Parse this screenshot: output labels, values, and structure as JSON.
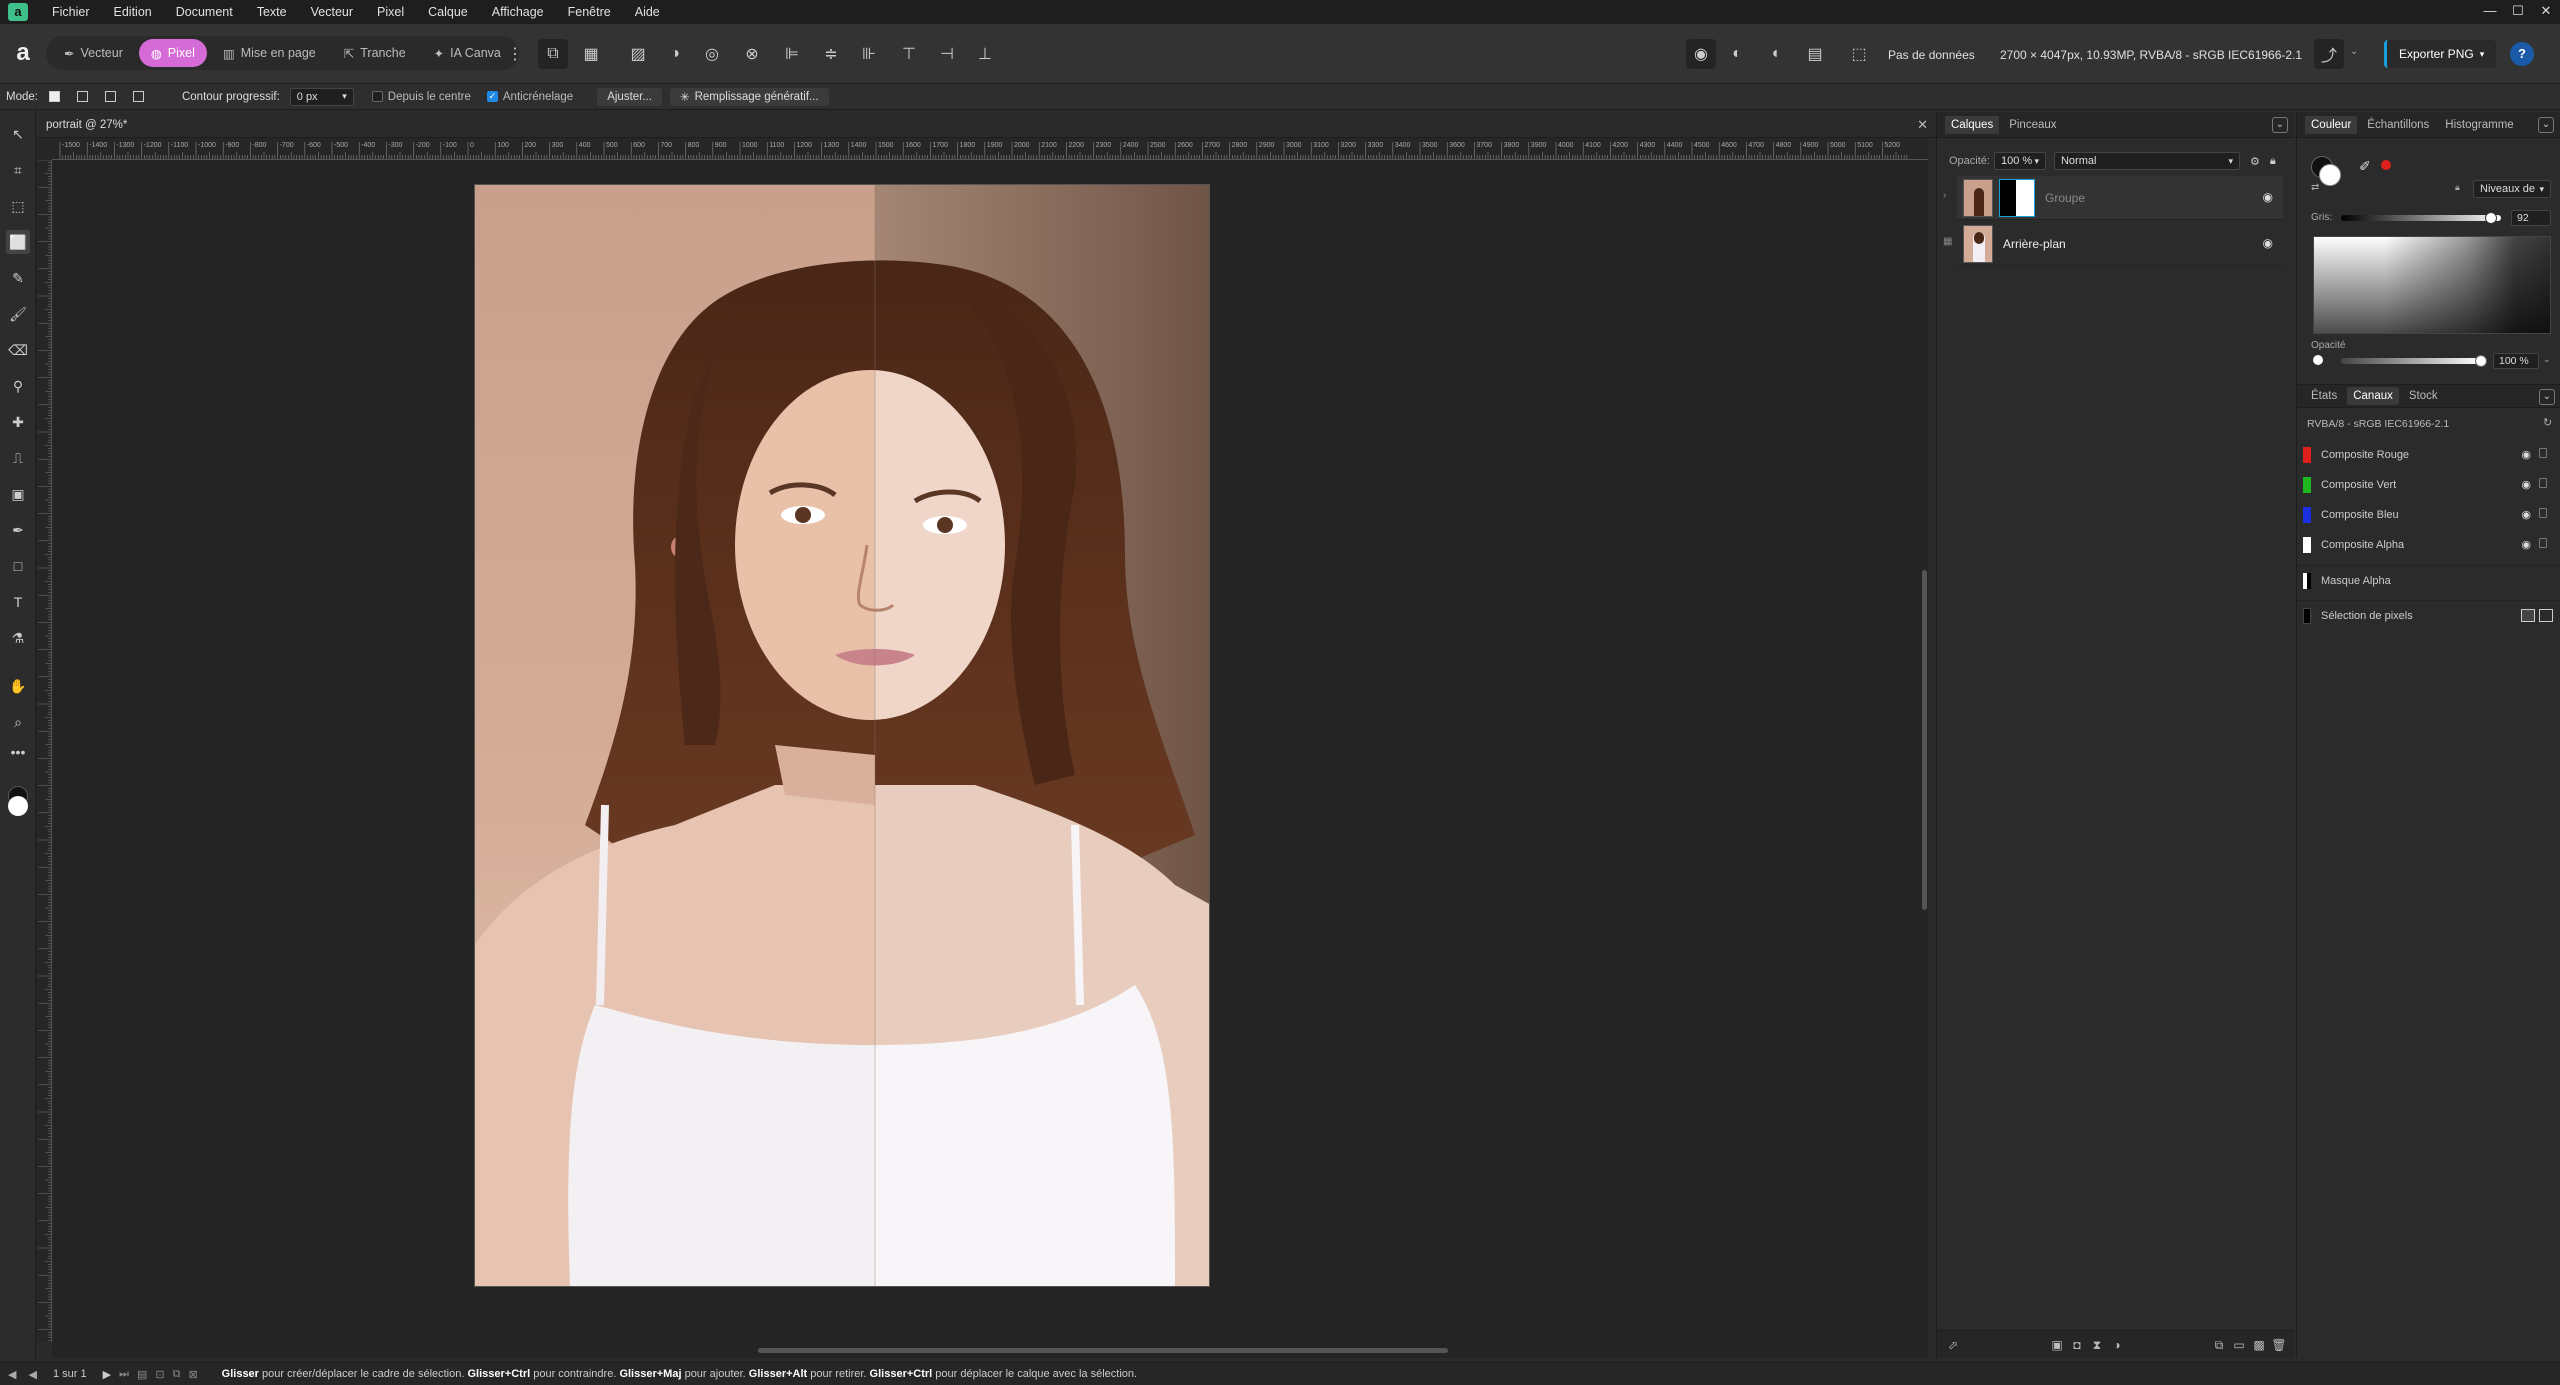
{
  "menu": {
    "items": [
      "Fichier",
      "Edition",
      "Document",
      "Texte",
      "Vecteur",
      "Pixel",
      "Calque",
      "Affichage",
      "Fenêtre",
      "Aide"
    ],
    "window_controls": [
      "—",
      "☐",
      "✕"
    ]
  },
  "toolbar": {
    "personas": [
      {
        "label": "Vecteur",
        "icon": "vector-pen-icon",
        "active": false
      },
      {
        "label": "Pixel",
        "icon": "pixel-icon",
        "active": true
      },
      {
        "label": "Mise en page",
        "icon": "layout-icon",
        "active": false
      },
      {
        "label": "Tranche",
        "icon": "export-slice-icon",
        "active": false
      },
      {
        "label": "IA Canva",
        "icon": "ai-sparkle-icon",
        "active": false
      }
    ],
    "no_data": "Pas de données",
    "doc_info": "2700 × 4047px, 10.93MP, RVBA/8 - sRGB IEC61966-2.1",
    "export_label": "Exporter PNG",
    "help": "?"
  },
  "context": {
    "mode_label": "Mode:",
    "feather_label": "Contour progressif:",
    "feather_value": "0 px",
    "from_center": "Depuis le centre",
    "antialias": "Anticrénelage",
    "adjust_btn": "Ajuster...",
    "generative_fill_btn": "Remplissage génératif..."
  },
  "document": {
    "tab_title": "portrait @ 27%*",
    "ruler_ticks": [
      "-1500",
      "-1400",
      "-1300",
      "-1200",
      "-1100",
      "-1000",
      "-900",
      "-800",
      "-700",
      "-600",
      "-500",
      "-400",
      "-300",
      "-200",
      "-100",
      "0",
      "100",
      "200",
      "300",
      "400",
      "500",
      "600",
      "700",
      "800",
      "900",
      "1000",
      "1100",
      "1200",
      "1300",
      "1400",
      "1500",
      "1600",
      "1700",
      "1800",
      "1900",
      "2000",
      "2100",
      "2200",
      "2300",
      "2400",
      "2500",
      "2600",
      "2700",
      "2800",
      "2900",
      "3000",
      "3100",
      "3200",
      "3300",
      "3400",
      "3500",
      "3600",
      "3700",
      "3800",
      "3900",
      "4000",
      "4100",
      "4200",
      "4300",
      "4400",
      "4500",
      "4600",
      "4700",
      "4800",
      "4900",
      "5000",
      "5100",
      "5200"
    ]
  },
  "layers": {
    "tabs": [
      {
        "label": "Calques",
        "active": true
      },
      {
        "label": "Pinceaux",
        "active": false
      }
    ],
    "opacity_label": "Opacité:",
    "opacity_value": "100 %",
    "blend_mode": "Normal",
    "items": [
      {
        "name": "Groupe",
        "dim": true
      },
      {
        "name": "Arrière-plan",
        "dim": false
      }
    ]
  },
  "color_panel": {
    "tabs": [
      {
        "label": "Couleur",
        "active": true
      },
      {
        "label": "Échantillons",
        "active": false
      },
      {
        "label": "Histogramme",
        "active": false
      }
    ],
    "mode": "Niveaux de",
    "gray_label": "Gris:",
    "gray_value": "92",
    "opacity_label": "Opacité",
    "opacity_value": "100 %",
    "accent_red": "#e0211b"
  },
  "channels": {
    "tabs": [
      {
        "label": "États",
        "active": false
      },
      {
        "label": "Canaux",
        "active": true
      },
      {
        "label": "Stock",
        "active": false
      }
    ],
    "profile": "RVBA/8 - sRGB IEC61966-2.1",
    "items": [
      {
        "name": "Composite Rouge",
        "color": "#e0211b"
      },
      {
        "name": "Composite Vert",
        "color": "#1db81d"
      },
      {
        "name": "Composite Bleu",
        "color": "#1b2ee0"
      },
      {
        "name": "Composite Alpha",
        "color": "#ffffff"
      },
      {
        "name": "Masque Alpha",
        "color": "#ffffff"
      },
      {
        "name": "Sélection de pixels",
        "color": "#000000"
      }
    ]
  },
  "status": {
    "page": "1 sur 1",
    "hint_1b": "Glisser",
    "hint_1": " pour créer/déplacer le cadre de sélection. ",
    "hint_2b": "Glisser+Ctrl",
    "hint_2": " pour contraindre. ",
    "hint_3b": "Glisser+Maj",
    "hint_3": " pour ajouter. ",
    "hint_4b": "Glisser+Alt",
    "hint_4": " pour retirer. ",
    "hint_5b": "Glisser+Ctrl",
    "hint_5": " pour déplacer le calque avec la sélection."
  }
}
